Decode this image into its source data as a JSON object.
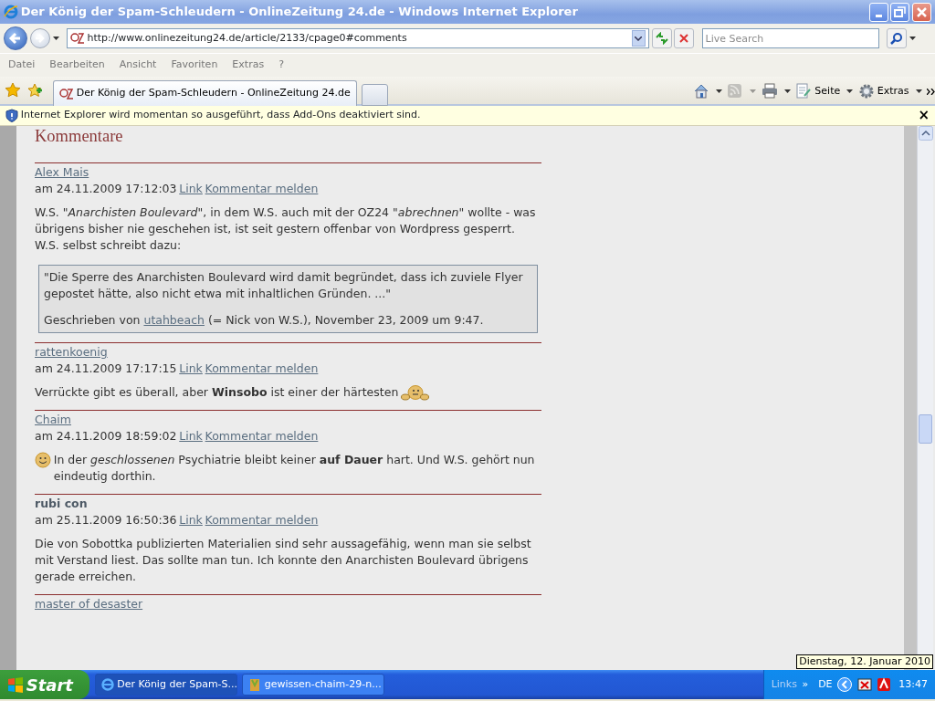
{
  "window": {
    "title": "Der König der Spam-Schleudern - OnlineZeitung 24.de - Windows Internet Explorer"
  },
  "address": {
    "url": "http://www.onlinezeitung24.de/article/2133/cpage0#comments"
  },
  "search": {
    "placeholder": "Live Search"
  },
  "menu": [
    "Datei",
    "Bearbeiten",
    "Ansicht",
    "Favoriten",
    "Extras",
    "?"
  ],
  "tabs": [
    {
      "label": "Der König der Spam-Schleudern - OnlineZeitung 24.de",
      "selected": true
    }
  ],
  "toolbar": [
    {
      "kind": "home",
      "disabled": false
    },
    {
      "kind": "feed",
      "disabled": true
    },
    {
      "kind": "print",
      "disabled": false
    },
    {
      "kind": "page",
      "label": "Seite",
      "disabled": false
    },
    {
      "kind": "tools",
      "label": "Extras",
      "disabled": false
    }
  ],
  "infobar": {
    "text": "Internet Explorer wird momentan so ausgeführt, dass Add-Ons deaktiviert sind.",
    "close": "×"
  },
  "page": {
    "heading": "Kommentare",
    "comments": [
      {
        "author": "Alex Mais",
        "author_linked": true,
        "date": "am 24.11.2009 17:12:03",
        "links": [
          "Link",
          "Kommentar melden"
        ],
        "paragraphs": [
          {
            "text": "W.S. *\"Anarchisten Boulevard\"*, in dem W.S. auch mit der OZ24 *\"abrechnen\"* wollte - was übrigens bisher nie geschehen ist, ist seit gestern offenbar von Wordpress gesperrt. W.S. selbst schreibt dazu:"
          }
        ],
        "quote": {
          "text": "\"Die Sperre des Anarchisten Boulevard wird damit begründet, dass ich zuviele Flyer gepostet hätte, also nicht etwa mit inhaltlichen Gründen. ...\"",
          "source_before": "Geschrieben von",
          "source_link": "utahbeach",
          "source_after": "(= Nick von W.S.), November 23, 2009 um 9:47."
        }
      },
      {
        "author": "rattenkoenig",
        "author_linked": true,
        "date": "am 24.11.2009 17:17:15",
        "links": [
          "Link",
          "Kommentar melden"
        ],
        "paragraphs": [
          {
            "text": "Verrückte gibt es überall, aber **Winsobo** ist einer der härtesten",
            "kind": "trailed"
          }
        ]
      },
      {
        "author": "Chaim",
        "author_linked": true,
        "date": "am 24.11.2009 18:59:02",
        "links": [
          "Link",
          "Kommentar melden"
        ],
        "paragraphs": [
          {
            "text": "In der *geschlossenen* Psychiatrie bleibt keiner **auf Dauer** hart. Und W.S. gehört nun eindeutig dorthin.",
            "kind": "led"
          }
        ]
      },
      {
        "author": "rubi con",
        "author_linked": false,
        "date": "am 25.11.2009 16:50:36",
        "links": [
          "Link",
          "Kommentar melden"
        ],
        "paragraphs": [
          {
            "text": "Die von Sobottka publizierten Materialien sind sehr aussagefähig, wenn man sie selbst mit Verstand liest. Das sollte man tun. Ich konnte den Anarchisten Boulevard übrigens gerade erreichen."
          }
        ]
      },
      {
        "author": "master of desaster",
        "author_linked": true
      }
    ]
  },
  "taskbar": {
    "start": "Start",
    "tasks": [
      {
        "label": "Der König der Spam-S...",
        "kind": "browser",
        "selected": true
      },
      {
        "label": "gewissen-chaim-29-n...",
        "kind": "file",
        "selected": false
      }
    ],
    "links": "Links",
    "chevron": "»",
    "language": "DE",
    "clock": "13:47",
    "tooltip": "Dienstag, 12. Januar 2010"
  }
}
